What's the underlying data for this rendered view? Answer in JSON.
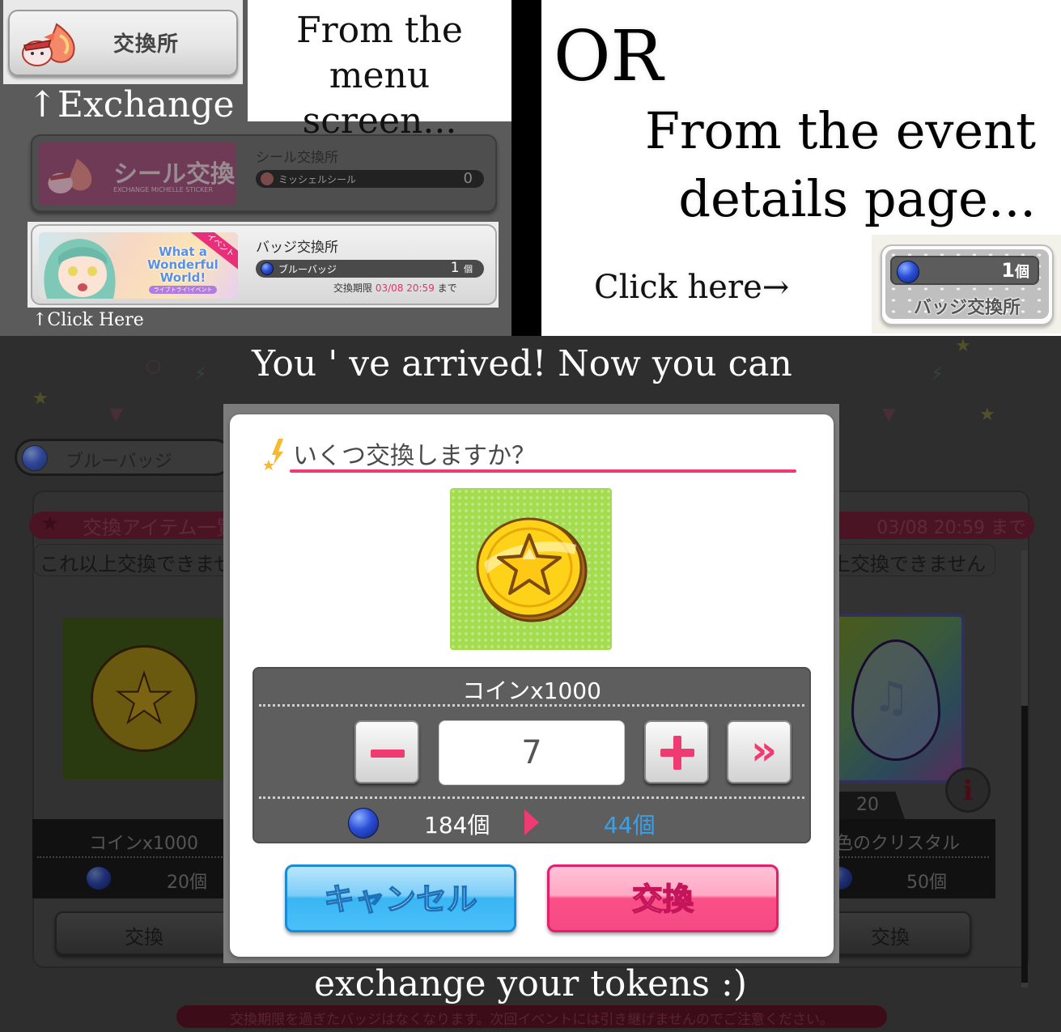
{
  "top_left": {
    "menu_button_label": "交換所",
    "exchange_caption": "↑Exchange",
    "menu_caption_line1": "From the",
    "menu_caption_line2": "menu screen...",
    "sticker_exchange": {
      "banner_title": "シール交換",
      "banner_subtitle": "EXCHANGE MICHELLE STICKER",
      "title": "シール交換所",
      "currency_name": "ミッシェルシール",
      "currency_count": "0"
    },
    "badge_exchange": {
      "banner_logo": "What a Wonderful World!",
      "banner_sub": "ライブトライ!イベント",
      "banner_ribbon": "イベント",
      "title": "バッジ交換所",
      "currency_name": "ブルーバッジ",
      "currency_count": "1",
      "currency_unit": "個",
      "deadline_label": "交換期限",
      "deadline_date": "03/08 20:59",
      "deadline_suffix": "まで"
    },
    "click_here_caption": "↑Click Here"
  },
  "top_right": {
    "or_text": "OR",
    "event_caption_line1": "From the event",
    "event_caption_line2": "details page...",
    "click_here_caption": "Click here→",
    "badge_shortcut": {
      "count": "1",
      "unit": "個",
      "label": "バッジ交換所"
    }
  },
  "bottom": {
    "arrived_caption": "You ' ve arrived! Now you can",
    "tokens_caption": "exchange your tokens :)",
    "background": {
      "currency_pill_name": "ブルーバッジ",
      "header_title": "交換アイテム一覧",
      "header_deadline": "03/08 20:59 まで",
      "notice_left": "これ以上交換できませ",
      "notice_right": "上交換できません",
      "left_item": {
        "name": "コインx1000",
        "price": "20個",
        "button": "交換"
      },
      "right_item": {
        "level": "20",
        "name": "色のクリスタル",
        "price": "50個",
        "button": "交換"
      },
      "footer_notice": "交換期限を過ぎたバッジはなくなります。次回イベントには引き継げませんのでご注意ください。"
    },
    "modal": {
      "title": "いくつ交換しますか？",
      "item_name": "コインx1000",
      "quantity": "7",
      "current_balance": "184個",
      "after_balance": "44個",
      "cancel_label": "キャンセル",
      "exchange_label": "交換",
      "max_label": "»"
    }
  },
  "colors": {
    "accent_pink": "#f03a72",
    "accent_blue": "#3aa0e8",
    "cancel_blue": "#3ab6f4",
    "exchange_pink": "#fb4f86",
    "item_bg_green": "#a4dc50"
  }
}
